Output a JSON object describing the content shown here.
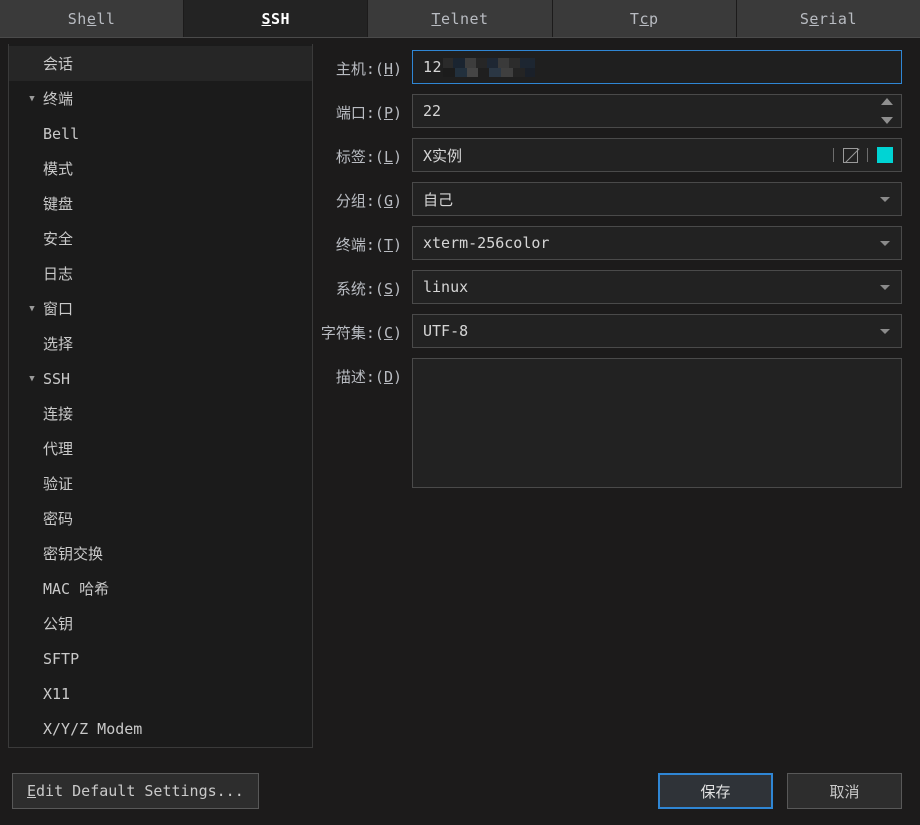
{
  "tabs": [
    {
      "label": "Shell",
      "accel_index": 2,
      "active": false,
      "name": "tab-shell"
    },
    {
      "label": "SSH",
      "accel_index": 0,
      "active": true,
      "name": "tab-ssh"
    },
    {
      "label": "Telnet",
      "accel_index": 0,
      "active": false,
      "name": "tab-telnet"
    },
    {
      "label": "Tcp",
      "accel_index": 1,
      "active": false,
      "name": "tab-tcp"
    },
    {
      "label": "Serial",
      "accel_index": 1,
      "active": false,
      "name": "tab-serial"
    }
  ],
  "sidebar": {
    "items": [
      {
        "label": "会话",
        "level": 0,
        "arrow": "",
        "selected": true,
        "name": "sidebar-item-session"
      },
      {
        "label": "终端",
        "level": 0,
        "arrow": "▼",
        "selected": false,
        "name": "sidebar-item-terminal"
      },
      {
        "label": "Bell",
        "level": 1,
        "arrow": "",
        "selected": false,
        "name": "sidebar-item-bell"
      },
      {
        "label": "模式",
        "level": 1,
        "arrow": "",
        "selected": false,
        "name": "sidebar-item-mode"
      },
      {
        "label": "键盘",
        "level": 1,
        "arrow": "",
        "selected": false,
        "name": "sidebar-item-keyboard"
      },
      {
        "label": "安全",
        "level": 1,
        "arrow": "",
        "selected": false,
        "name": "sidebar-item-security"
      },
      {
        "label": "日志",
        "level": 1,
        "arrow": "",
        "selected": false,
        "name": "sidebar-item-log"
      },
      {
        "label": "窗口",
        "level": 0,
        "arrow": "▼",
        "selected": false,
        "name": "sidebar-item-window"
      },
      {
        "label": "选择",
        "level": 1,
        "arrow": "",
        "selected": false,
        "name": "sidebar-item-selection"
      },
      {
        "label": "SSH",
        "level": 0,
        "arrow": "▼",
        "selected": false,
        "name": "sidebar-item-ssh"
      },
      {
        "label": "连接",
        "level": 1,
        "arrow": "",
        "selected": false,
        "name": "sidebar-item-connection"
      },
      {
        "label": "代理",
        "level": 1,
        "arrow": "",
        "selected": false,
        "name": "sidebar-item-proxy"
      },
      {
        "label": "验证",
        "level": 1,
        "arrow": "",
        "selected": false,
        "name": "sidebar-item-authentication"
      },
      {
        "label": "密码",
        "level": 1,
        "arrow": "",
        "selected": false,
        "name": "sidebar-item-password"
      },
      {
        "label": "密钥交换",
        "level": 1,
        "arrow": "",
        "selected": false,
        "name": "sidebar-item-key-exchange"
      },
      {
        "label": "MAC 哈希",
        "level": 1,
        "arrow": "",
        "selected": false,
        "name": "sidebar-item-mac-hash"
      },
      {
        "label": "公钥",
        "level": 1,
        "arrow": "",
        "selected": false,
        "name": "sidebar-item-public-key"
      },
      {
        "label": "SFTP",
        "level": 1,
        "arrow": "",
        "selected": false,
        "name": "sidebar-item-sftp"
      },
      {
        "label": "X11",
        "level": 1,
        "arrow": "",
        "selected": false,
        "name": "sidebar-item-x11"
      },
      {
        "label": "X/Y/Z Modem",
        "level": 0,
        "arrow": "",
        "selected": false,
        "name": "sidebar-item-xyz-modem"
      }
    ]
  },
  "form": {
    "host": {
      "label_text": "主机:(",
      "accel": "H",
      "label_close": ")",
      "value": "12",
      "redacted": true,
      "focused": true
    },
    "port": {
      "label_text": "端口:(",
      "accel": "P",
      "label_close": ")",
      "value": "22"
    },
    "tag": {
      "label_text": "标签:(",
      "accel": "L",
      "label_close": ")",
      "value": "X实例",
      "color_swatch": "#00d4d4"
    },
    "group": {
      "label_text": "分组:(",
      "accel": "G",
      "label_close": ")",
      "value": "自己"
    },
    "terminal": {
      "label_text": "终端:(",
      "accel": "T",
      "label_close": ")",
      "value": "xterm-256color"
    },
    "system": {
      "label_text": "系统:(",
      "accel": "S",
      "label_close": ")",
      "value": "linux"
    },
    "charset": {
      "label_text": "字符集:(",
      "accel": "C",
      "label_close": ")",
      "value": "UTF-8"
    },
    "description": {
      "label_text": "描述:(",
      "accel": "D",
      "label_close": ")",
      "value": "",
      "placeholder": ""
    }
  },
  "footer": {
    "edit_defaults": {
      "label": "Edit Default Settings...",
      "accel_index": 0
    },
    "save": {
      "label": "保存",
      "primary": true
    },
    "cancel": {
      "label": "取消",
      "primary": false
    }
  },
  "colors": {
    "accent_focus": "#2f86d4",
    "swatch": "#00d4d4",
    "panel_bg": "#1c1b1b",
    "sidebar_bg": "#1b1b1b",
    "tab_inactive": "#3a3a3a",
    "tab_active": "#232323"
  }
}
